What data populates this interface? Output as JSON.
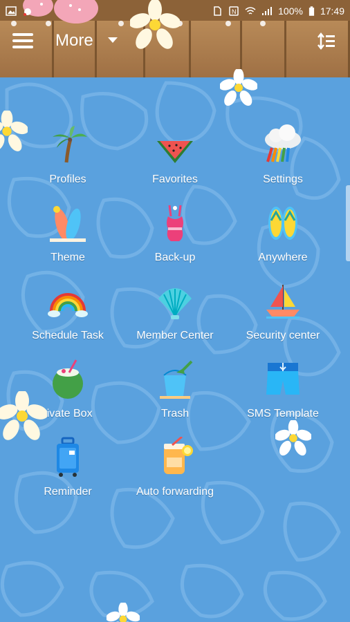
{
  "status_bar": {
    "battery": "100%",
    "time": "17:49",
    "icons": [
      "gallery-icon",
      "strawberry-icon",
      "sim-icon",
      "nfc-icon",
      "wifi-icon",
      "signal-icon",
      "battery-icon"
    ]
  },
  "header": {
    "title": "More",
    "menu_icon": "hamburger-menu-icon",
    "sort_icon": "sort-icon"
  },
  "items": [
    {
      "label": "Profiles",
      "icon": "palm-tree-icon"
    },
    {
      "label": "Favorites",
      "icon": "watermelon-icon"
    },
    {
      "label": "Settings",
      "icon": "rainbow-cloud-icon"
    },
    {
      "label": "Theme",
      "icon": "surfboard-icon"
    },
    {
      "label": "Back-up",
      "icon": "swimsuit-icon"
    },
    {
      "label": "Anywhere",
      "icon": "flip-flops-icon"
    },
    {
      "label": "Schedule Task",
      "icon": "rainbow-icon"
    },
    {
      "label": "Member Center",
      "icon": "seashell-icon"
    },
    {
      "label": "Security center",
      "icon": "sailboat-icon"
    },
    {
      "label": "rivate Box",
      "icon": "coconut-drink-icon"
    },
    {
      "label": "Trash",
      "icon": "sand-bucket-icon"
    },
    {
      "label": "SMS Template",
      "icon": "swim-shorts-icon"
    },
    {
      "label": "Reminder",
      "icon": "suitcase-icon"
    },
    {
      "label": "Auto forwarding",
      "icon": "juice-jar-icon"
    }
  ],
  "colors": {
    "water": "#5aa1de",
    "wood": "#a97b4c",
    "text": "#ffffff"
  }
}
